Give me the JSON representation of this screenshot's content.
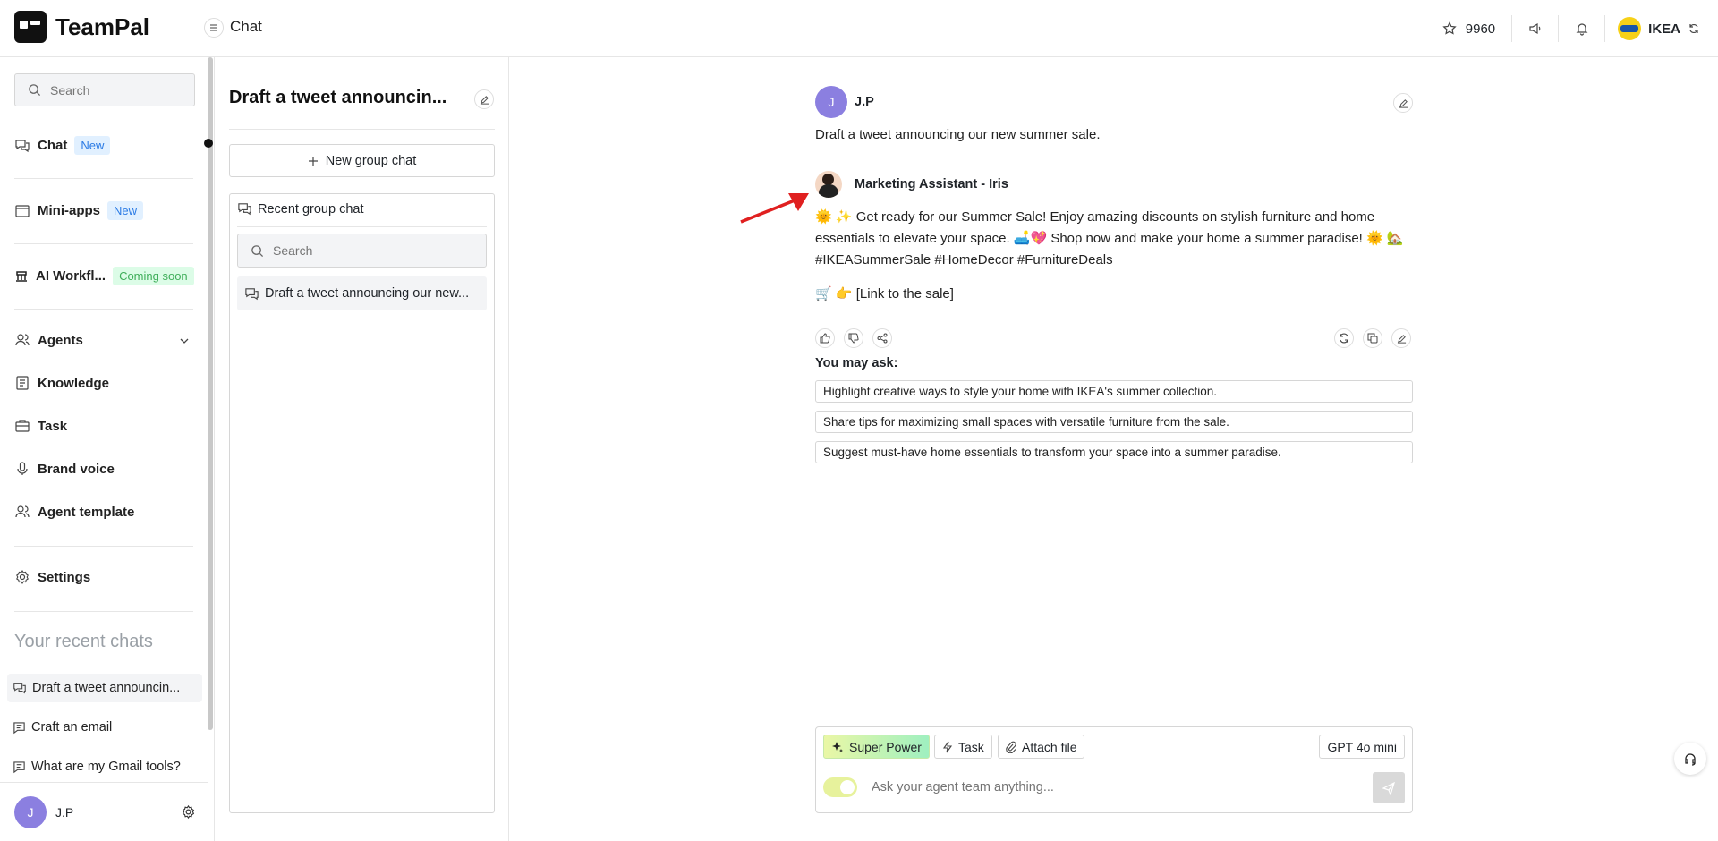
{
  "app": {
    "name": "TeamPal",
    "page_title": "Chat"
  },
  "topbar": {
    "credits": "9960",
    "org_name": "IKEA"
  },
  "sidebar": {
    "search_placeholder": "Search",
    "nav": [
      {
        "label": "Chat",
        "badge": "New",
        "icon": "chat-icon"
      },
      {
        "label": "Mini-apps",
        "badge": "New",
        "icon": "window-icon"
      },
      {
        "label": "AI Workfl...",
        "badge": "Coming soon",
        "icon": "workflow-icon"
      },
      {
        "label": "Agents",
        "icon": "users-icon"
      },
      {
        "label": "Knowledge",
        "icon": "book-icon"
      },
      {
        "label": "Task",
        "icon": "briefcase-icon"
      },
      {
        "label": "Brand voice",
        "icon": "microphone-icon"
      },
      {
        "label": "Agent template",
        "icon": "users-icon"
      },
      {
        "label": "Settings",
        "icon": "gear-icon"
      }
    ],
    "recent_title": "Your recent chats",
    "recent": [
      "Draft a tweet announcin...",
      "Craft an email",
      "What are my Gmail tools?"
    ],
    "user": {
      "initial": "J",
      "name": "J.P"
    }
  },
  "middle": {
    "title": "Draft a tweet announcin...",
    "new_group_label": "New group chat",
    "recent_group_label": "Recent group chat",
    "search_placeholder": "Search",
    "items": [
      "Draft a tweet announcing our new..."
    ]
  },
  "chat": {
    "user_msg": {
      "initial": "J",
      "name": "J.P",
      "text": "Draft a tweet announcing our new summer sale."
    },
    "agent_msg": {
      "name": "Marketing Assistant - Iris",
      "line1": "🌞 ✨ Get ready for our Summer Sale! Enjoy amazing discounts on stylish furniture and home",
      "line2": "essentials to elevate your space. 🛋️💖 Shop now and make your home a summer paradise! 🌞 🏡",
      "line3": "#IKEASummerSale #HomeDecor #FurnitureDeals",
      "link": "🛒 👉 [Link to the sale]"
    },
    "you_may_ask": "You may ask:",
    "suggestions": [
      "Highlight creative ways to style your home with IKEA's summer collection.",
      "Share tips for maximizing small spaces with versatile furniture from the sale.",
      "Suggest must-have home essentials to transform your space into a summer paradise."
    ]
  },
  "composer": {
    "super_power": "Super Power",
    "task": "Task",
    "attach": "Attach file",
    "model": "GPT 4o mini",
    "placeholder": "Ask your agent team anything..."
  },
  "colors": {
    "accent_purple": "#8b7fe0",
    "badge_blue": "#2b7be5",
    "badge_green": "#3fae5a",
    "arrow_red": "#e02020"
  }
}
